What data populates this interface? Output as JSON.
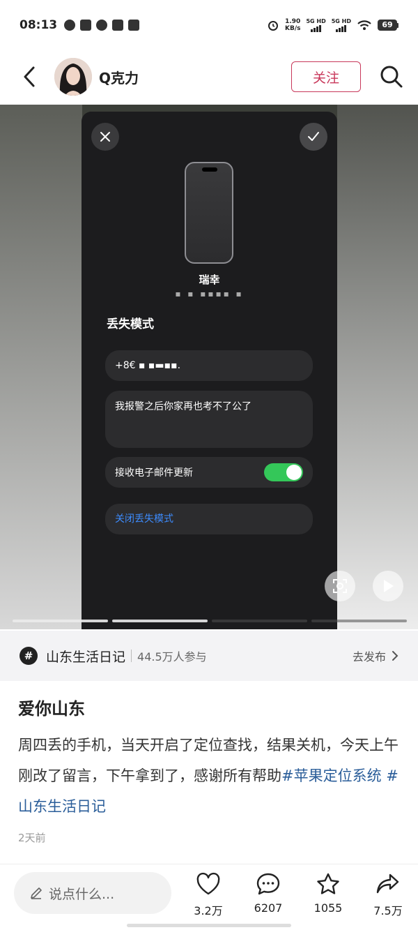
{
  "status_bar": {
    "time": "08:13",
    "net_speed_value": "1.90",
    "net_speed_unit": "KB/s",
    "signal1_label": "5G HD",
    "signal2_label": "5G HD",
    "battery": "69"
  },
  "header": {
    "author_name": "Q克力",
    "follow_label": "关注"
  },
  "media": {
    "device_name": "瑞幸",
    "device_sub": "▪ ▪ ▪▪▪▪ ▪",
    "lost_mode_title": "丢失模式",
    "phone_value": "+8€ ▪ ▪▬▪▪.",
    "message_value": "我报警之后你家再也考不了公了",
    "email_updates_label": "接收电子邮件更新",
    "email_updates_on": true,
    "turn_off_label": "关闭丢失模式",
    "progress_total": 4,
    "progress_done": 2
  },
  "topic": {
    "icon": "#",
    "name": "山东生活日记",
    "count": "44.5万人参与",
    "action": "去发布"
  },
  "post": {
    "title": "爱你山东",
    "body": "周四丢的手机，当天开启了定位查找，结果关机，今天上午刚改了留言，下午拿到了，感谢所有帮助",
    "tag1": "#苹果定位系统",
    "tag2": "#山东生活日记",
    "time": "2天前"
  },
  "bottom_bar": {
    "comment_placeholder": "说点什么...",
    "likes": "3.2万",
    "comments": "6207",
    "stars": "1055",
    "shares": "7.5万"
  },
  "colors": {
    "accent": "#c8375a",
    "hashtag": "#2a5d99",
    "toggle_on": "#34c759",
    "link_blue": "#3d8bfd"
  },
  "icons": {
    "back": "chevron-left-icon",
    "search": "search-icon",
    "close": "close-icon",
    "confirm": "check-icon",
    "topic": "hashtag-icon",
    "pencil": "pencil-icon",
    "like": "heart-icon",
    "comment": "chat-bubble-icon",
    "star": "star-icon",
    "share": "share-icon"
  }
}
